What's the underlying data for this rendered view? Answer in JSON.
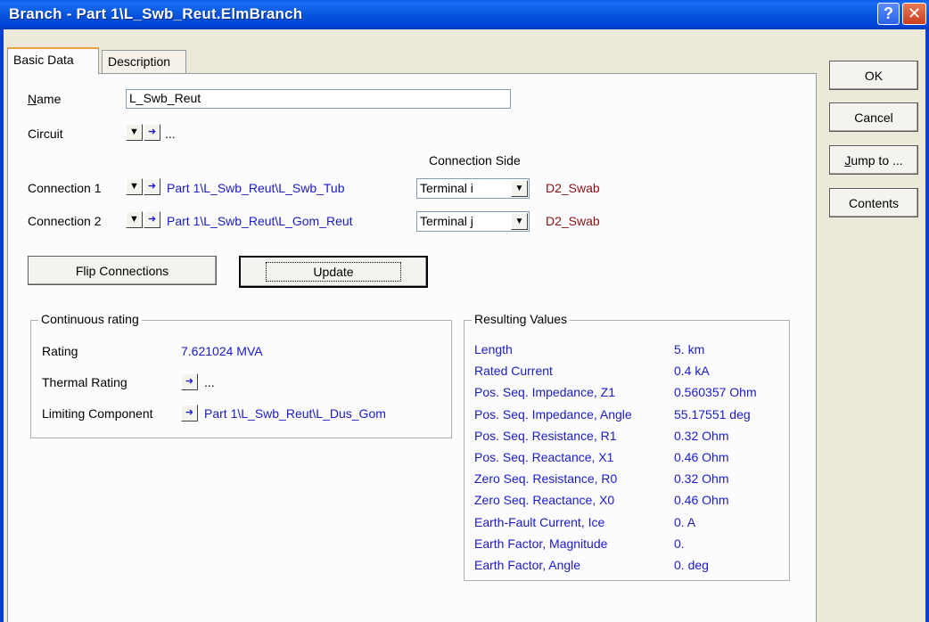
{
  "window": {
    "title": "Branch - Part 1\\L_Swb_Reut.ElmBranch",
    "help_glyph": "?",
    "close_glyph": "✕"
  },
  "tabs": [
    {
      "label": "Basic Data"
    },
    {
      "label": "Description"
    }
  ],
  "name_field": {
    "label_first": "N",
    "label_rest": "ame",
    "value": "L_Swb_Reut"
  },
  "circuit": {
    "label": "Circuit",
    "value": "..."
  },
  "connection_side_header": "Connection Side",
  "connections": [
    {
      "label": "Connection 1",
      "path": "Part 1\\L_Swb_Reut\\L_Swb_Tub",
      "side": "Terminal i",
      "node": "D2_Swab"
    },
    {
      "label": "Connection 2",
      "path": "Part 1\\L_Swb_Reut\\L_Gom_Reut",
      "side": "Terminal j",
      "node": "D2_Swab"
    }
  ],
  "buttons": {
    "flip": "Flip Connections",
    "update": "Update"
  },
  "continuous_rating": {
    "title": "Continuous rating",
    "rating_label": "Rating",
    "rating_value": "7.621024 MVA",
    "thermal_label": "Thermal Rating",
    "thermal_value": "...",
    "limiting_label": "Limiting Component",
    "limiting_value": "Part 1\\L_Swb_Reut\\L_Dus_Gom"
  },
  "resulting_values": {
    "title": "Resulting Values",
    "rows": [
      {
        "label": "Length",
        "value": "5. km"
      },
      {
        "label": "Rated Current",
        "value": "0.4 kA"
      },
      {
        "label": "Pos. Seq. Impedance, Z1",
        "value": "0.560357 Ohm"
      },
      {
        "label": "Pos. Seq. Impedance, Angle",
        "value": "55.17551 deg"
      },
      {
        "label": "Pos. Seq. Resistance, R1",
        "value": "0.32 Ohm"
      },
      {
        "label": "Pos. Seq. Reactance, X1",
        "value": "0.46 Ohm"
      },
      {
        "label": "Zero Seq. Resistance, R0",
        "value": "0.32 Ohm"
      },
      {
        "label": "Zero Seq. Reactance, X0",
        "value": "0.46 Ohm"
      },
      {
        "label": "Earth-Fault Current, Ice",
        "value": "0. A"
      },
      {
        "label": "Earth Factor, Magnitude",
        "value": "0."
      },
      {
        "label": "Earth Factor, Angle",
        "value": "0. deg"
      }
    ]
  },
  "side_buttons": {
    "ok": "OK",
    "cancel": "Cancel",
    "jump_first": "J",
    "jump_rest": "ump to ...",
    "contents": "Contents"
  },
  "colors": {
    "title_bar": "#0a5bec",
    "link_blue": "#1a1ac8",
    "node_red": "#8a1010"
  }
}
